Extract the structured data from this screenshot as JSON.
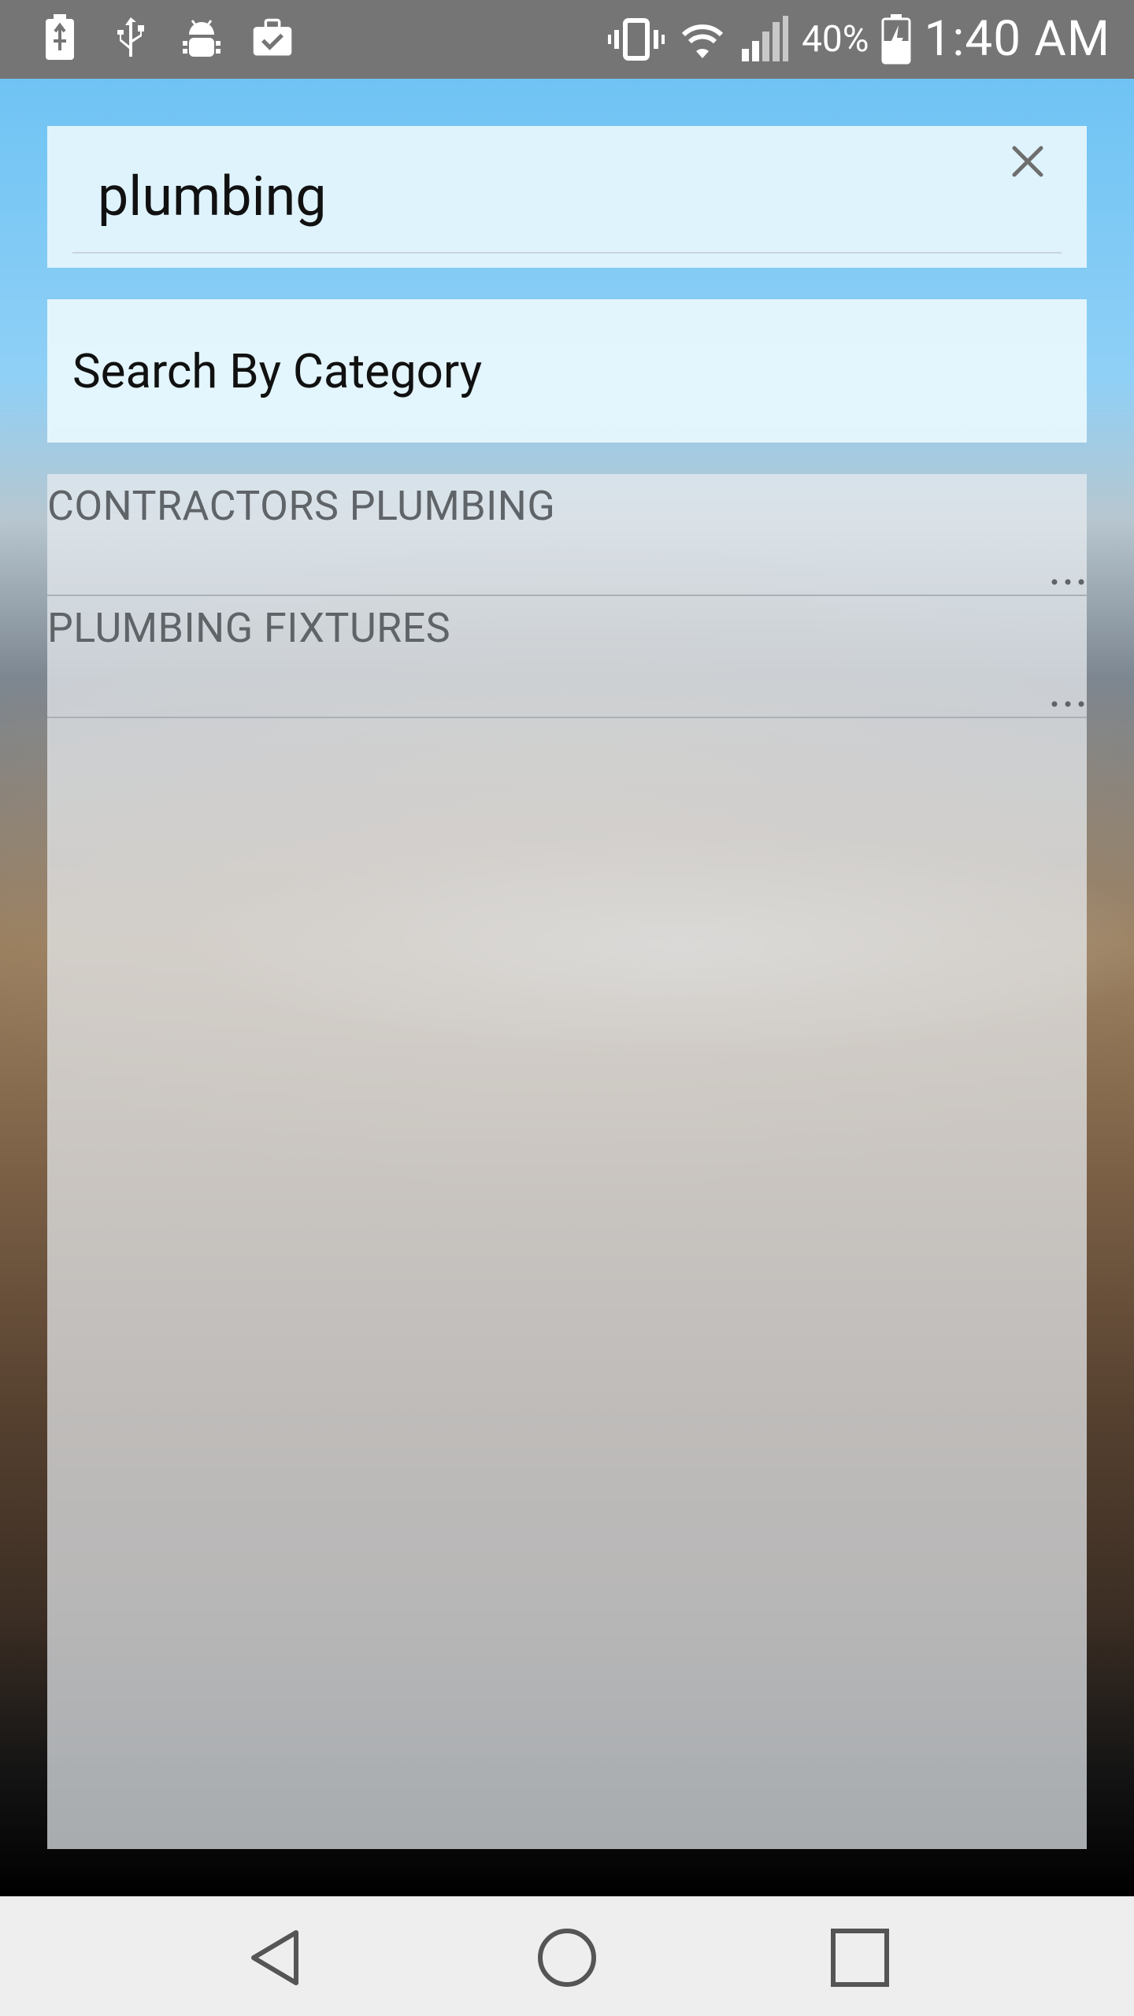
{
  "status_bar": {
    "left_icons": [
      "usb-battery-icon",
      "usb-icon",
      "android-debug-icon",
      "briefcase-check-icon"
    ],
    "right_icons": [
      "vibrate-icon",
      "wifi-icon",
      "signal-icon",
      "battery-charging-icon"
    ],
    "battery_percent": "40%",
    "time": "1:40 AM"
  },
  "search": {
    "value": "plumbing",
    "clear_icon": "close-icon"
  },
  "category_button": {
    "label": "Search By Category"
  },
  "results": [
    {
      "title": "CONTRACTORS PLUMBING",
      "more_icon": "more-horiz-icon"
    },
    {
      "title": "PLUMBING FIXTURES",
      "more_icon": "more-horiz-icon"
    }
  ],
  "nav_bar": {
    "buttons": [
      "back-icon",
      "home-icon",
      "recents-icon"
    ]
  },
  "colors": {
    "status_bar": "#757575",
    "search_card": "#e3f5fd",
    "result_text": "#5f6469",
    "nav_bar": "#eeeeee"
  }
}
